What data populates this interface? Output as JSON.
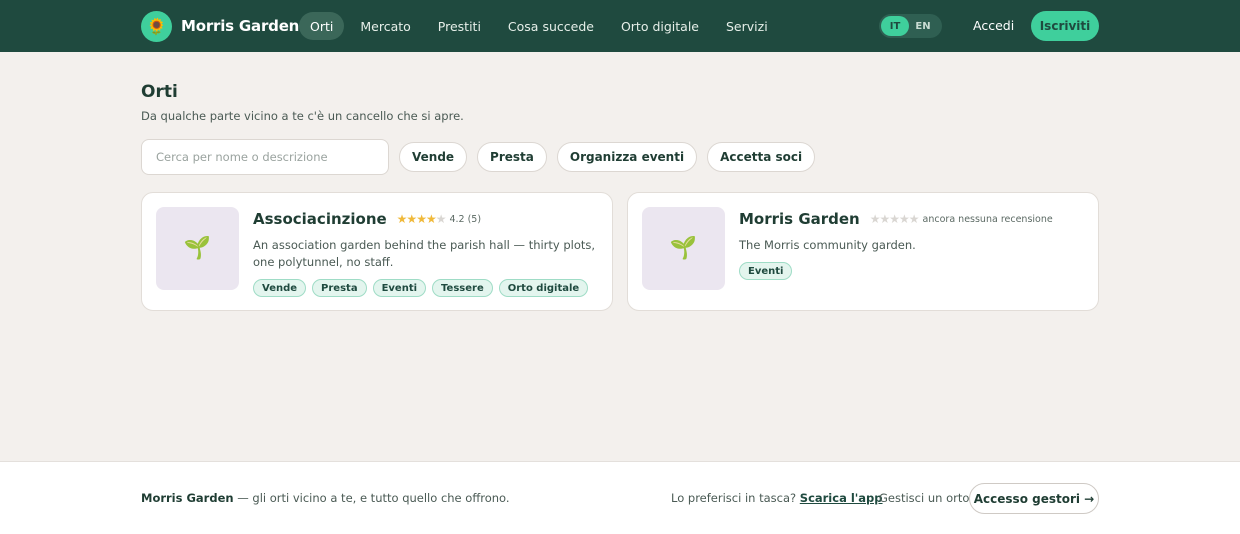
{
  "header": {
    "brand_name": "Morris Garden",
    "brand_icon": "sunflower-icon",
    "nav": [
      {
        "label": "Orti",
        "active": true
      },
      {
        "label": "Mercato"
      },
      {
        "label": "Prestiti"
      },
      {
        "label": "Cosa succede"
      },
      {
        "label": "Orto digitale"
      },
      {
        "label": "Servizi"
      }
    ],
    "lang": {
      "it": "IT",
      "en": "EN",
      "active": "IT"
    },
    "login_label": "Accedi",
    "signup_label": "Iscriviti"
  },
  "main": {
    "title": "Orti",
    "subtitle": "Da qualche parte vicino a te c'è un cancello che si apre.",
    "search": {
      "placeholder": "Cerca per nome o descrizione",
      "value": ""
    },
    "filters": [
      "Vende",
      "Presta",
      "Organizza eventi",
      "Accetta soci"
    ],
    "cards": [
      {
        "title": "Associacinzione",
        "rating": 4.2,
        "rating_text": "4.2 (5)",
        "description": "An association garden behind the parish hall — thirty plots, one polytunnel, no staff.",
        "tags": [
          "Vende",
          "Presta",
          "Eventi",
          "Tessere",
          "Orto digitale"
        ],
        "thumb_icon": "seedling-icon"
      },
      {
        "title": "Morris Garden",
        "rating": 0,
        "rating_text": "ancora nessuna recensione",
        "description": "The Morris community garden.",
        "tags": [
          "Eventi"
        ],
        "thumb_icon": "seedling-icon"
      }
    ]
  },
  "footer": {
    "brand": "Morris Garden",
    "tagline": " — gli orti vicino a te, e tutto quello che offrono.",
    "app_question": "Lo preferisci in tasca? ",
    "app_link": "Scarica l'app",
    "manage_question": "Gestisci un orto?",
    "manager_button": "Accesso gestori →"
  },
  "colors": {
    "header_bg": "#1f4a3f",
    "accent": "#3fcf9c",
    "page_bg": "#f3f0ed",
    "star": "#f0b93a"
  }
}
